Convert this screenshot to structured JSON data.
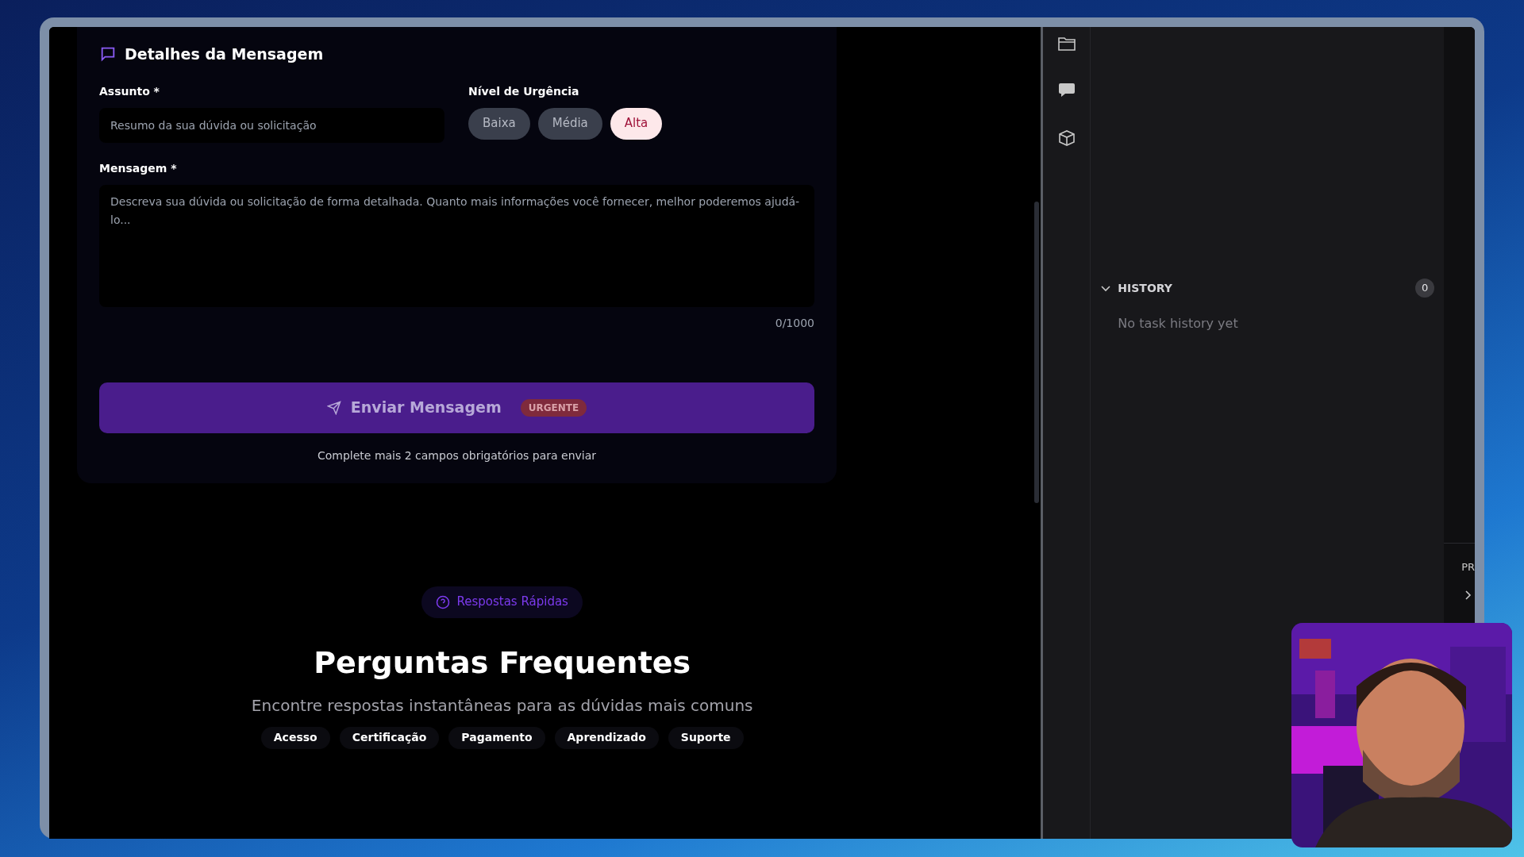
{
  "form": {
    "title": "Detalhes da Mensagem",
    "subject": {
      "label": "Assunto *",
      "placeholder": "Resumo da sua dúvida ou solicitação"
    },
    "urgency": {
      "label": "Nível de Urgência",
      "options": [
        {
          "label": "Baixa",
          "selected": false
        },
        {
          "label": "Média",
          "selected": false
        },
        {
          "label": "Alta",
          "selected": true
        }
      ]
    },
    "message": {
      "label": "Mensagem *",
      "placeholder": "Descreva sua dúvida ou solicitação de forma detalhada. Quanto mais informações você fornecer, melhor poderemos ajudá-lo...",
      "counter": "0/1000"
    },
    "submit": {
      "label": "Enviar Mensagem",
      "badge": "URGENTE",
      "disabled": true
    },
    "hint": "Complete mais 2 campos obrigatórios para enviar"
  },
  "faq": {
    "badge": "Respostas Rápidas",
    "title": "Perguntas Frequentes",
    "subtitle": "Encontre respostas instantâneas para as dúvidas mais comuns",
    "categories": [
      "Acesso",
      "Certificação",
      "Pagamento",
      "Aprendizado",
      "Suporte"
    ]
  },
  "sidebar": {
    "history": {
      "title": "HISTORY",
      "count": "0",
      "expanded": true,
      "empty": "No task history yet"
    }
  },
  "right_panel": {
    "label": "PR"
  }
}
